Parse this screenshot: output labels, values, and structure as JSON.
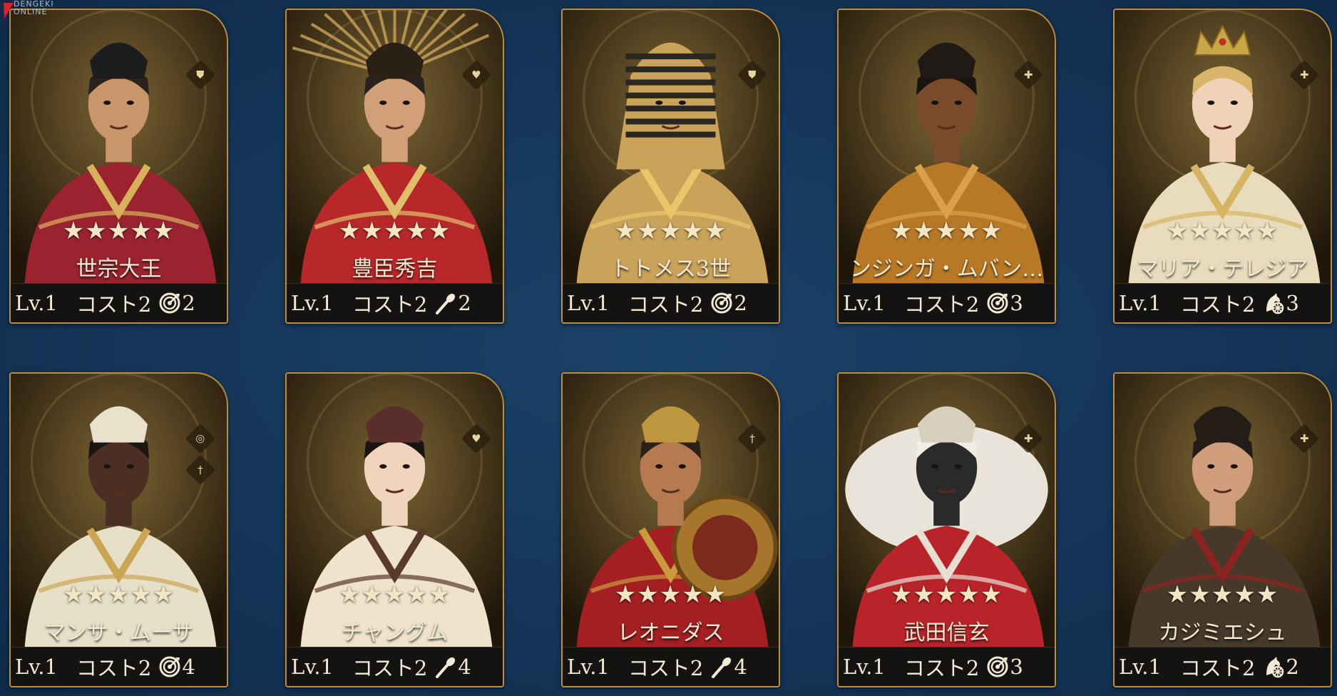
{
  "watermark": {
    "brand": "DENGEKI",
    "sub": "ONLINE"
  },
  "colors": {
    "background": "#143457",
    "card_border": "#b98f3f",
    "footer_bg": "#141311",
    "text": "#f2ead6"
  },
  "cards": [
    {
      "name": "世宗大王",
      "stars": "★★★★★",
      "level": "Lv.1",
      "cost": "コスト2",
      "resource_icon": "target-icon",
      "resource_value": "2",
      "role_icons": [
        "shield-icon"
      ],
      "portrait": "king-in-red-robe"
    },
    {
      "name": "豊臣秀吉",
      "stars": "★★★★★",
      "level": "Lv.1",
      "cost": "コスト2",
      "resource_icon": "torch-icon",
      "resource_value": "2",
      "role_icons": [
        "heart-plus-icon"
      ],
      "portrait": "samurai-with-sunburst-helmet"
    },
    {
      "name": "トトメス3世",
      "stars": "★★★★★",
      "level": "Lv.1",
      "cost": "コスト2",
      "resource_icon": "target-icon",
      "resource_value": "2",
      "role_icons": [
        "shield-icon"
      ],
      "portrait": "pharaoh"
    },
    {
      "name": "ンジンガ・ムバン…",
      "stars": "★★★★★",
      "level": "Lv.1",
      "cost": "コスト2",
      "resource_icon": "target-icon",
      "resource_value": "3",
      "role_icons": [
        "plus-icon"
      ],
      "portrait": "african-queen"
    },
    {
      "name": "マリア・テレジア",
      "stars": "★★★★★",
      "level": "Lv.1",
      "cost": "コスト2",
      "resource_icon": "horse-wheel-icon",
      "resource_value": "3",
      "role_icons": [
        "plus-icon"
      ],
      "portrait": "empress-with-crown"
    },
    {
      "name": "マンサ・ムーサ",
      "stars": "★★★★★",
      "level": "Lv.1",
      "cost": "コスト2",
      "resource_icon": "target-icon",
      "resource_value": "4",
      "role_icons": [
        "spiral-icon",
        "sword-icon"
      ],
      "portrait": "emperor-in-white-turban"
    },
    {
      "name": "チャングム",
      "stars": "★★★★★",
      "level": "Lv.1",
      "cost": "コスト2",
      "resource_icon": "torch-icon",
      "resource_value": "4",
      "role_icons": [
        "heart-plus-icon"
      ],
      "portrait": "court-lady-hanbok"
    },
    {
      "name": "レオニダス",
      "stars": "★★★★★",
      "level": "Lv.1",
      "cost": "コスト2",
      "resource_icon": "torch-icon",
      "resource_value": "4",
      "role_icons": [
        "sword-icon"
      ],
      "portrait": "spartan-warrior"
    },
    {
      "name": "武田信玄",
      "stars": "★★★★★",
      "level": "Lv.1",
      "cost": "コスト2",
      "resource_icon": "target-icon",
      "resource_value": "3",
      "role_icons": [
        "plus-icon"
      ],
      "portrait": "samurai-in-white-mane"
    },
    {
      "name": "カジミエシュ",
      "stars": "★★★★★",
      "level": "Lv.1",
      "cost": "コスト2",
      "resource_icon": "horse-wheel-icon",
      "resource_value": "2",
      "role_icons": [
        "plus-icon"
      ],
      "portrait": "general-in-fur-coat"
    }
  ]
}
